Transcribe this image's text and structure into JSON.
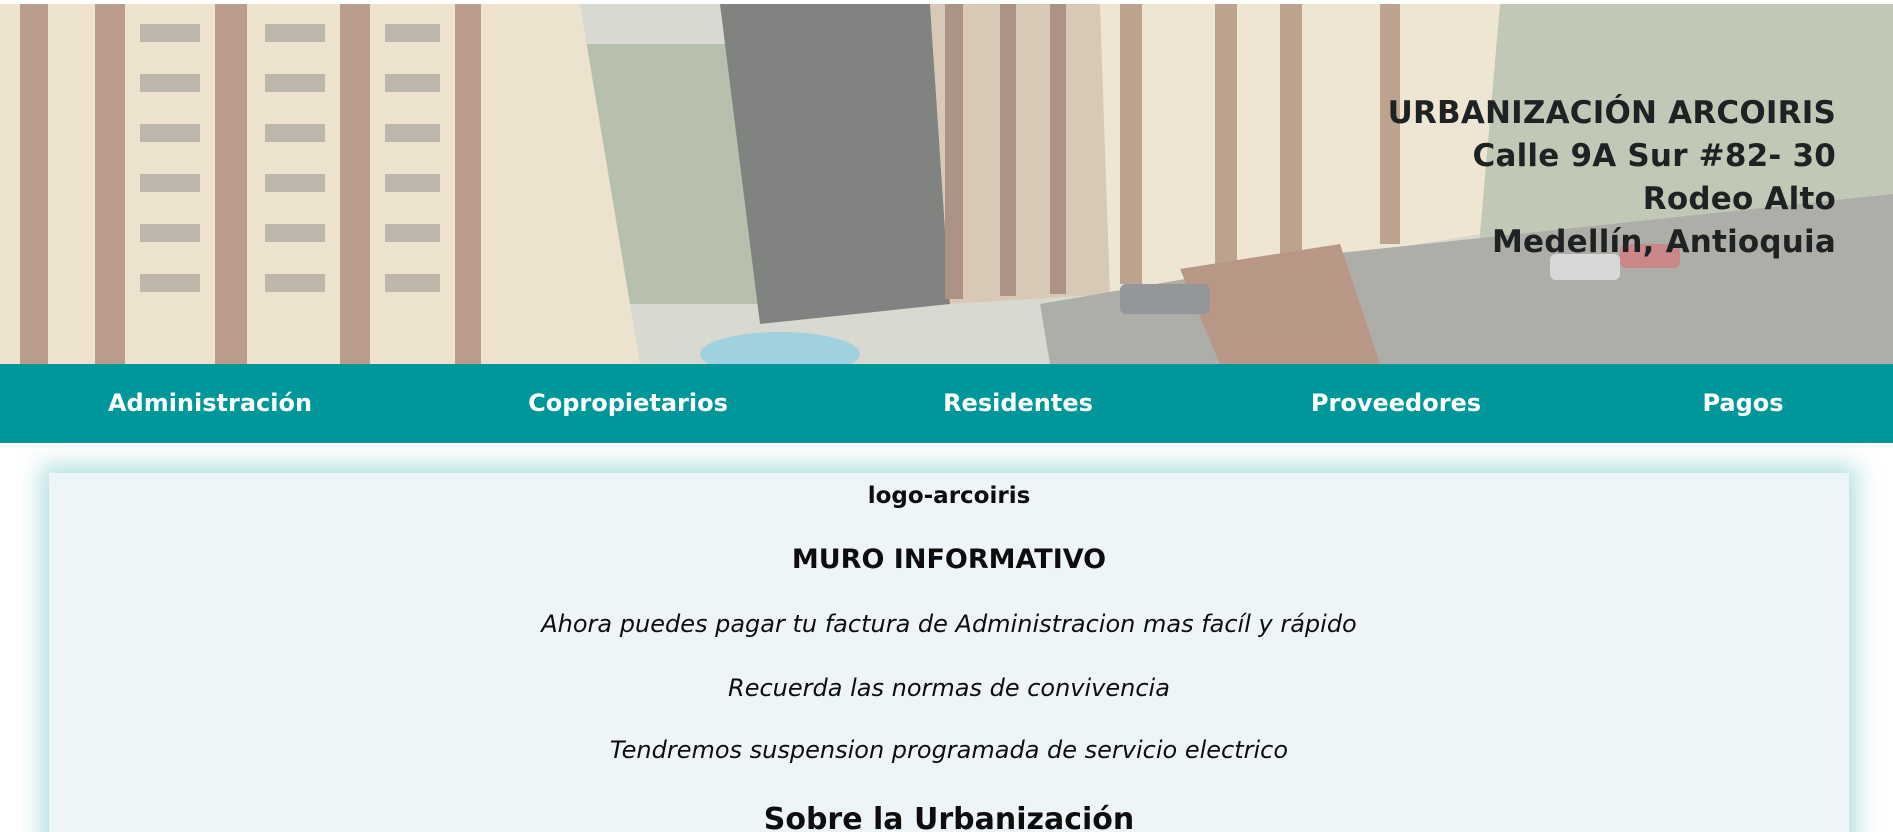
{
  "header": {
    "address_lines": [
      "URBANIZACIÓN ARCOIRIS",
      "Calle 9A Sur #82- 30",
      "Rodeo Alto",
      "Medellín, Antioquia"
    ]
  },
  "nav": {
    "items": [
      {
        "label": "Administración"
      },
      {
        "label": "Copropietarios"
      },
      {
        "label": "Residentes"
      },
      {
        "label": "Proveedores"
      },
      {
        "label": "Pagos"
      }
    ]
  },
  "main": {
    "logo_alt": "logo-arcoiris",
    "wall_title": "MURO INFORMATIVO",
    "notices": [
      "Ahora puedes pagar tu factura de Administracion mas facíl y rápido",
      "Recuerda las normas de convivencia",
      "Tendremos suspension programada de servicio electrico"
    ],
    "about_title": "Sobre la Urbanización"
  },
  "colors": {
    "accent": "#00979a",
    "card_background": "#eef5f8",
    "text": "#0d0d0d"
  }
}
